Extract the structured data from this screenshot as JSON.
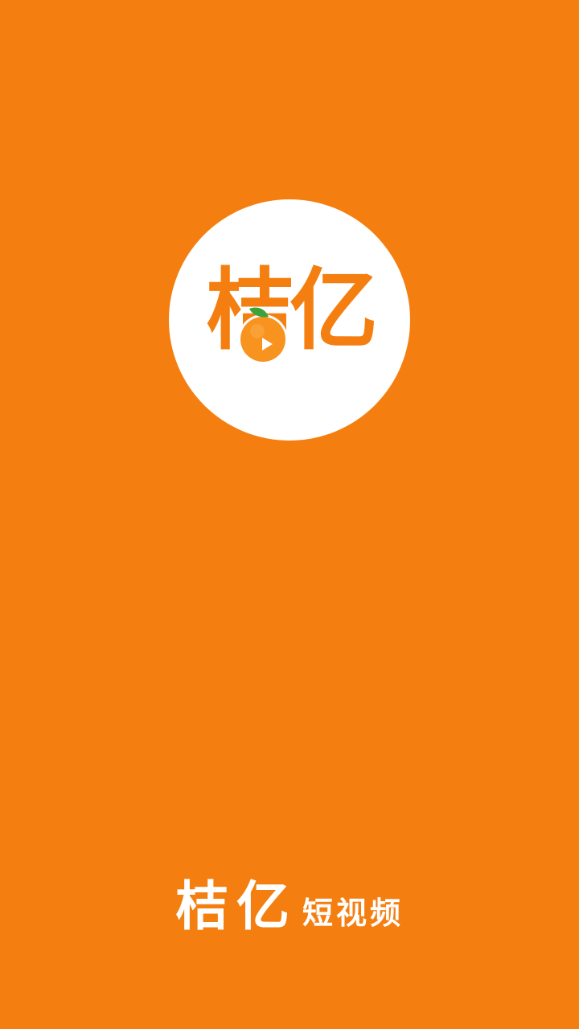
{
  "logo": {
    "text": "桔亿",
    "icon": "orange-play-icon",
    "colors": {
      "circle": "#ffffff",
      "text": "#f47f10",
      "orange": "#f7931e",
      "leaf": "#3aa33a"
    }
  },
  "brand": {
    "name": "桔亿",
    "subtitle": "短视频"
  },
  "colors": {
    "background": "#f47f10",
    "text": "#ffffff"
  }
}
